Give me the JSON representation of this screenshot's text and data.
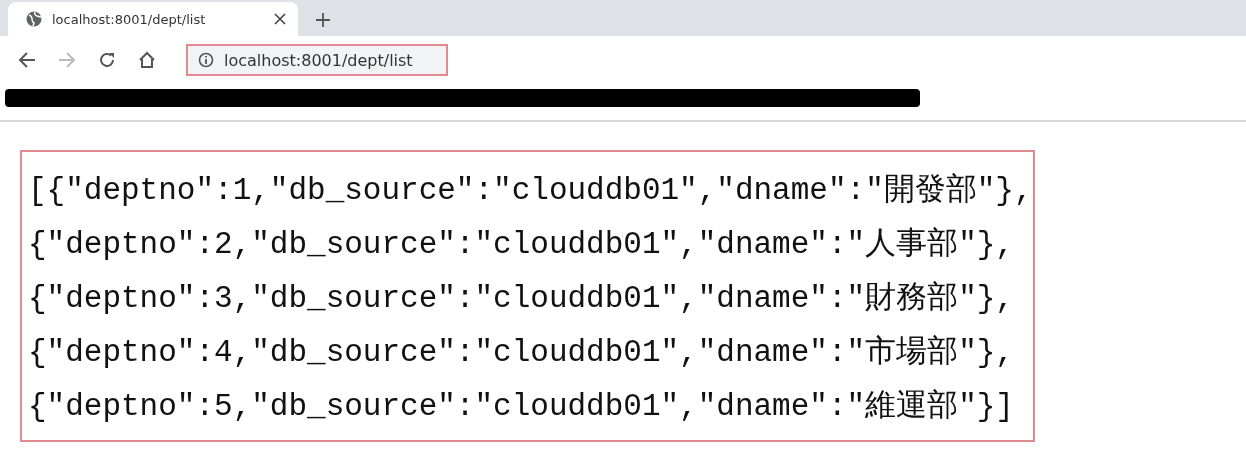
{
  "tab": {
    "title": "localhost:8001/dept/list",
    "selected": true
  },
  "address_bar": {
    "url": "localhost:8001/dept/list"
  },
  "nav": {
    "forward_disabled": true
  },
  "body_lines": [
    "[{\"deptno\":1,\"db_source\":\"clouddb01\",\"dname\":\"開發部\"},",
    "{\"deptno\":2,\"db_source\":\"clouddb01\",\"dname\":\"人事部\"},",
    "{\"deptno\":3,\"db_source\":\"clouddb01\",\"dname\":\"財務部\"},",
    "{\"deptno\":4,\"db_source\":\"clouddb01\",\"dname\":\"市場部\"},",
    "{\"deptno\":5,\"db_source\":\"clouddb01\",\"dname\":\"維運部\"}]"
  ]
}
